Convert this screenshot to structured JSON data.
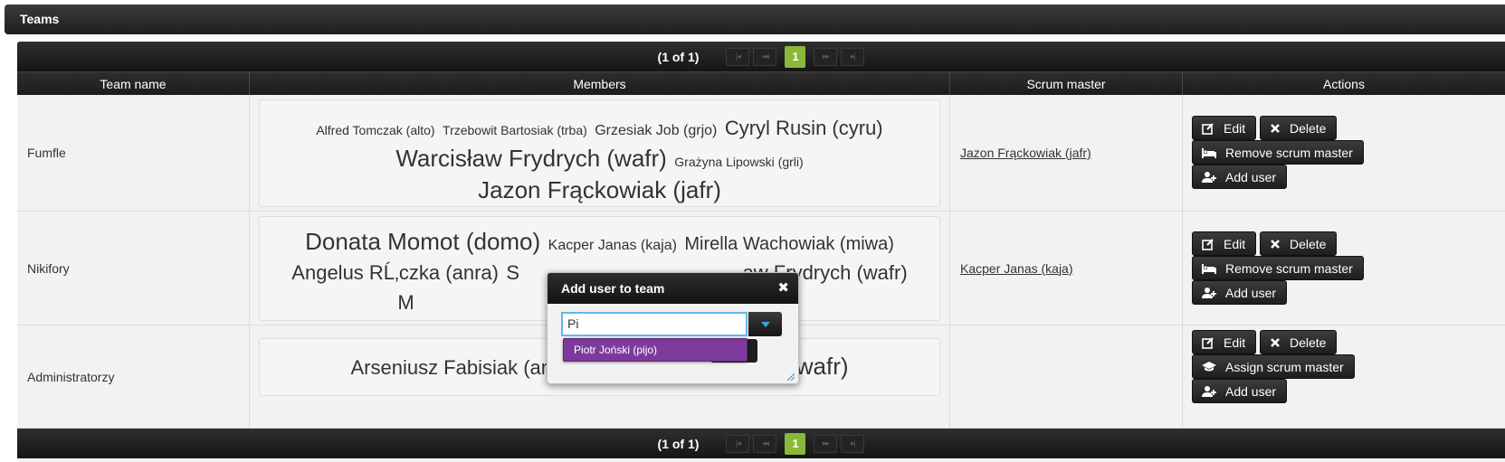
{
  "panel": {
    "title": "Teams"
  },
  "paginator": {
    "info": "(1 of 1)",
    "first": "|◂",
    "prev": "◂◂",
    "page": "1",
    "next": "▸▸",
    "last": "▸|"
  },
  "columns": {
    "team_name": "Team name",
    "members": "Members",
    "scrum_master": "Scrum master",
    "actions": "Actions"
  },
  "rows": [
    {
      "team_name": "Fumfle",
      "members": [
        "Alfred Tomczak (alto)",
        "Trzebowit Bartosiak (trba)",
        "Grzesiak Job (grjo)",
        "Cyryl Rusin (cyru)",
        "Warcisław Frydrych (wafr)",
        "Grażyna Lipowski (grli)",
        "Jazon Frąckowiak (jafr)"
      ],
      "scrum_master": "Jazon Frąckowiak (jafr)",
      "actions": {
        "edit": "Edit",
        "delete": "Delete",
        "scrum": "Remove scrum master",
        "add_user": "Add user"
      }
    },
    {
      "team_name": "Nikifory",
      "members": [
        "Donata Momot (domo)",
        "Kacper Janas (kaja)",
        "Mirella Wachowiak (miwa)",
        "Angelus RĹ‚czka (anra)",
        "S",
        "aw Frydrych (wafr)",
        "M"
      ],
      "scrum_master": "Kacper Janas (kaja)",
      "actions": {
        "edit": "Edit",
        "delete": "Delete",
        "scrum": "Remove scrum master",
        "add_user": "Add user"
      }
    },
    {
      "team_name": "Administratorzy",
      "members": [
        "Arseniusz Fabisiak (ana)",
        "Warcisław Frydrych (wafr)"
      ],
      "scrum_master": "",
      "actions": {
        "edit": "Edit",
        "delete": "Delete",
        "scrum": "Assign scrum master",
        "add_user": "Add user"
      }
    }
  ],
  "dialog": {
    "title": "Add user to team",
    "close": "✖",
    "input_value": "Pi",
    "suggestion": "Piotr Joński (pijo)"
  },
  "colors": {
    "accent_green": "#8ab83a",
    "suggestion_purple": "#7d3a9c",
    "input_focus": "#62b8ea"
  }
}
